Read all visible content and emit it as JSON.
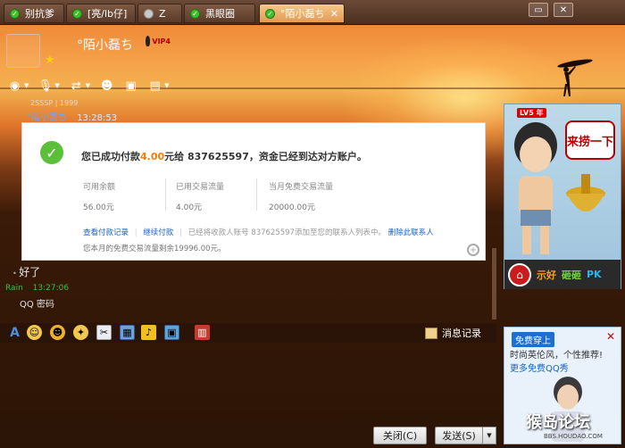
{
  "tabs": [
    {
      "label": "别抗爹",
      "status": "online"
    },
    {
      "label": "[亮/lb仔]",
      "status": "online"
    },
    {
      "label": "Z",
      "status": "offline"
    },
    {
      "label": "黑眼圈",
      "status": "online"
    },
    {
      "label": "°陌小磊ち",
      "status": "online",
      "active": true
    }
  ],
  "window_controls": {
    "restore": "▭",
    "close": "✕"
  },
  "header": {
    "nickname": "°陌小磊ち",
    "vip": "VIP4"
  },
  "toolbar_icons": [
    "webcam-icon",
    "mic-icon",
    "transfer-icon",
    "add-contact-icon",
    "remote-desktop-icon",
    "app-icon"
  ],
  "chat": {
    "partial_line": "2SSSP | 1999",
    "msg1_name": "°陌小磊ち",
    "msg1_time": "13:28:53",
    "msg2_text": "好了",
    "msg3_name": "Rain",
    "msg3_time": "13:27:06",
    "msg3_text": "QQ 密码"
  },
  "payment": {
    "msg_prefix": "您已成功付款",
    "amount": "4.00",
    "msg_suffix": "元给 837625597，资金已经到达对方账户。",
    "stats": [
      {
        "label": "可用余额",
        "value": "56.00元"
      },
      {
        "label": "已用交易流量",
        "value": "4.00元"
      },
      {
        "label": "当月免费交易流量",
        "value": "20000.00元"
      }
    ],
    "link_records": "查看付款记录",
    "link_continue": "继续付款",
    "added_text": "已经将收款人账号 837625597添加至您的联系人列表中。",
    "link_delete": "删除此联系人",
    "quota_text": "您本月的免费交易流量剩余19996.00元。"
  },
  "show_panel": {
    "level": "LV5 年",
    "lao": "来捞一下",
    "actions": [
      "示好",
      "砸砸",
      "PK"
    ]
  },
  "history_label": "消息记录",
  "ad": {
    "tag": "免费穿上",
    "line1": "时尚英伦风，个性推荐!",
    "line2": "更多免费QQ秀",
    "watermark": "猴岛论坛",
    "watermark_url": "BBS.HOUDAO.COM"
  },
  "buttons": {
    "close": "关闭(C)",
    "send": "发送(S)"
  },
  "colors": {
    "accent": "#e49a52",
    "link": "#1a62c4",
    "success": "#5cbf3a",
    "amount": "#ff7a00"
  }
}
